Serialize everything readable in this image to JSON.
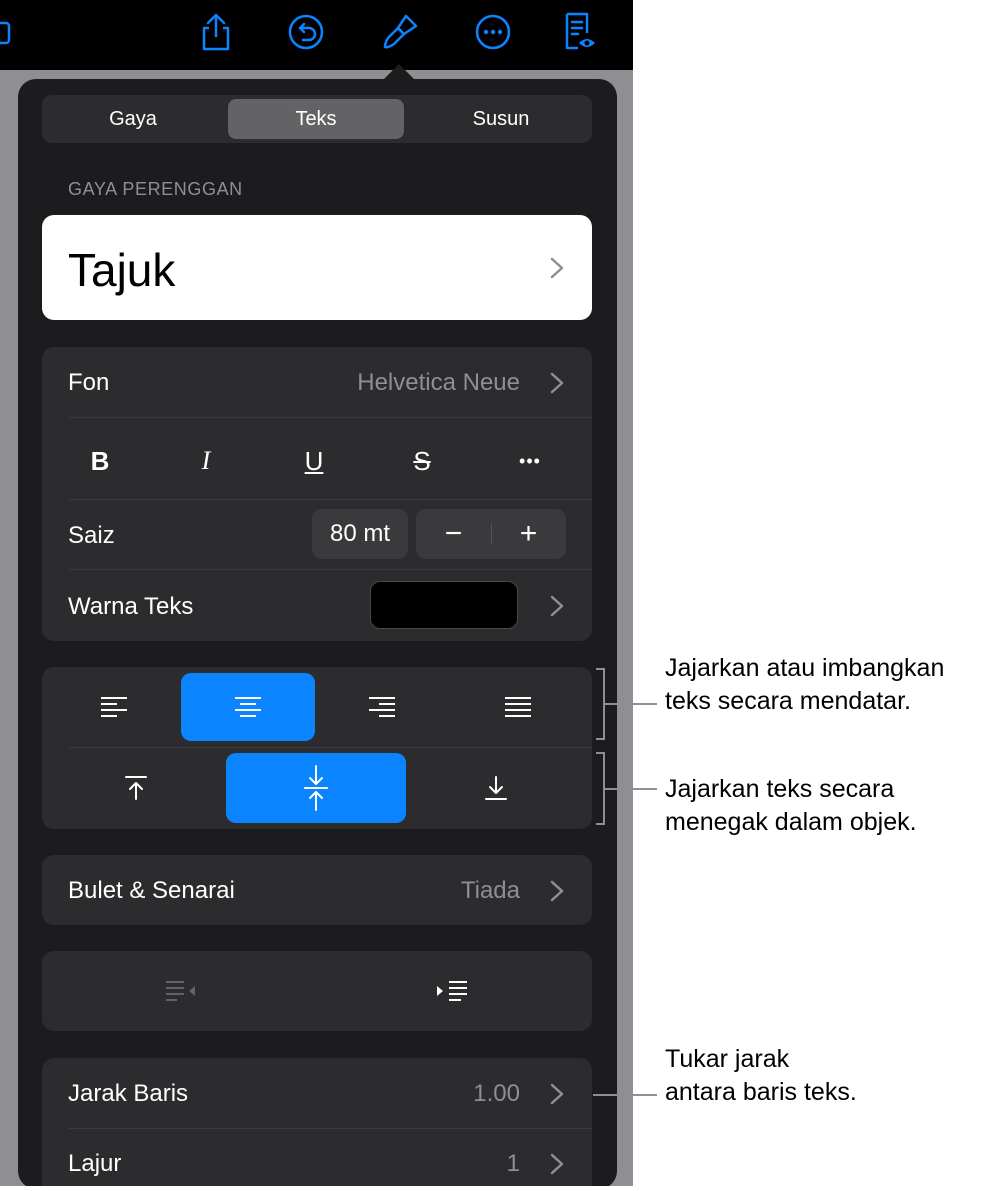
{
  "toolbar": {
    "icons": [
      "media-icon",
      "share-icon",
      "undo-icon",
      "format-brush-icon",
      "more-icon",
      "reading-view-icon"
    ],
    "accent": "#0a84ff"
  },
  "tabs": [
    {
      "label": "Gaya",
      "selected": false
    },
    {
      "label": "Teks",
      "selected": true
    },
    {
      "label": "Susun",
      "selected": false
    }
  ],
  "paragraph_style": {
    "section_label": "GAYA PERENGGAN",
    "value": "Tajuk"
  },
  "font": {
    "label": "Fon",
    "value": "Helvetica Neue"
  },
  "format_buttons": [
    "B",
    "I",
    "U",
    "S",
    "•••"
  ],
  "size": {
    "label": "Saiz",
    "value": "80 mt",
    "minus": "−",
    "plus": "+"
  },
  "text_color": {
    "label": "Warna Teks",
    "color": "#000000"
  },
  "horizontal_alignment": {
    "options": [
      "align-left-icon",
      "align-center-icon",
      "align-right-icon",
      "justify-icon"
    ],
    "selected": "align-center-icon"
  },
  "vertical_alignment": {
    "options": [
      "align-top-icon",
      "align-middle-icon",
      "align-bottom-icon"
    ],
    "selected": "align-middle-icon"
  },
  "bullets": {
    "label": "Bulet & Senarai",
    "value": "Tiada"
  },
  "indent": {
    "options": [
      "decrease-indent-icon",
      "increase-indent-icon"
    ]
  },
  "line_spacing": {
    "label": "Jarak Baris",
    "value": "1.00"
  },
  "columns": {
    "label": "Lajur",
    "value": "1"
  },
  "callouts": {
    "horizontal": [
      "Jajarkan atau imbangkan",
      "teks secara mendatar."
    ],
    "vertical": [
      "Jajarkan teks secara",
      "menegak dalam objek."
    ],
    "spacing": [
      "Tukar jarak",
      "antara baris teks."
    ]
  },
  "colors": {
    "panel": "#1c1c1e",
    "card": "#2c2c2e",
    "selected_segment": "#636366",
    "selected_alignment": "#0a84ff"
  }
}
